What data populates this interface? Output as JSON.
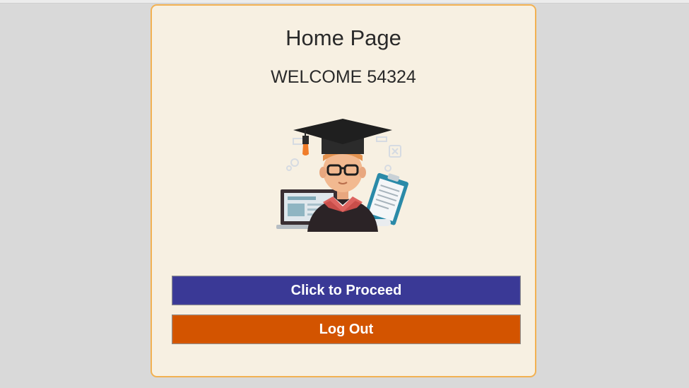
{
  "page": {
    "title": "Home Page",
    "welcome": "WELCOME 54324"
  },
  "illustration": {
    "icon": "graduate-student-icon"
  },
  "actions": {
    "proceed_label": "Click to Proceed",
    "logout_label": "Log Out"
  },
  "colors": {
    "background": "#d9d9d9",
    "card": "#f7f0e2",
    "card_border": "#f2b152",
    "proceed_button": "#3a3996",
    "logout_button": "#d35400"
  }
}
